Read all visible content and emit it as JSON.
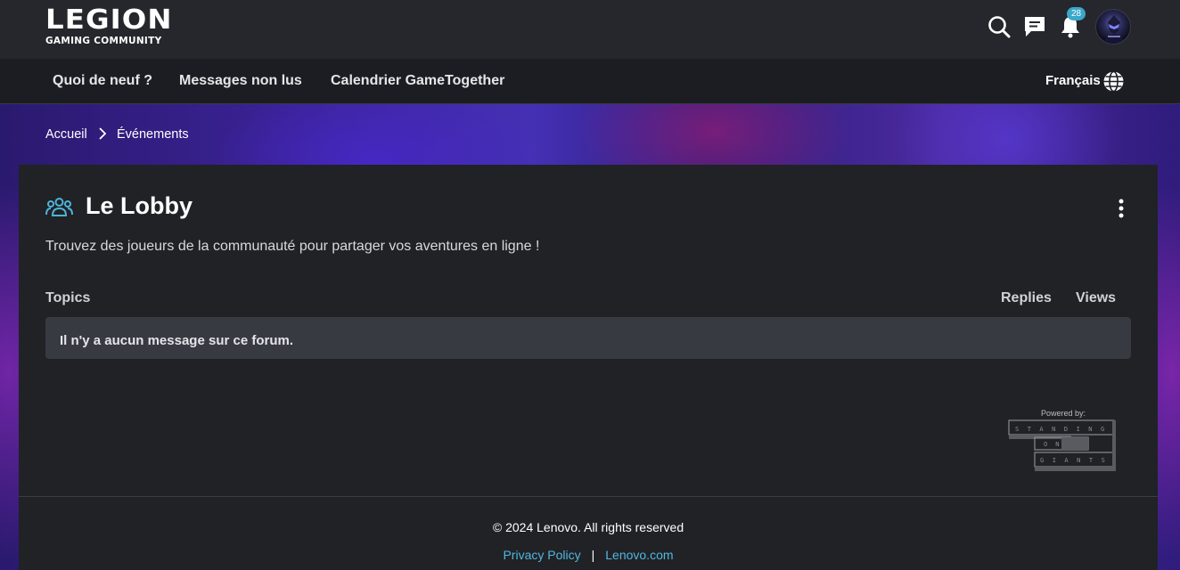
{
  "brand": {
    "name": "LEGION",
    "subtitle": "GAMING COMMUNITY"
  },
  "header": {
    "notification_count": "28",
    "icons": [
      "search-icon",
      "messages-icon",
      "bell-icon"
    ]
  },
  "nav": {
    "items": [
      "Quoi de neuf ?",
      "Messages non lus",
      "Calendrier GameTogether"
    ],
    "language": "Français"
  },
  "breadcrumb": {
    "home": "Accueil",
    "current": "Événements"
  },
  "board": {
    "title": "Le Lobby",
    "description": "Trouvez des joueurs de la communauté pour partager vos aventures en ligne !",
    "col_topics": "Topics",
    "col_replies": "Replies",
    "col_views": "Views",
    "empty_message": "Il n'y a aucun message sur ce forum."
  },
  "powered_by": {
    "label": "Powered by:",
    "logo_text": "STANDING ON GIANTS"
  },
  "footer": {
    "copyright": "© 2024 Lenovo. All rights reserved",
    "privacy": "Privacy Policy",
    "separator": "|",
    "lenovo": "Lenovo.com"
  },
  "colors": {
    "header_bg": "#25272d",
    "nav_bg": "#1c1d22",
    "card_bg": "#202226",
    "row_bg": "#383a42",
    "accent": "#52b7de",
    "badge": "#39a8c9"
  }
}
